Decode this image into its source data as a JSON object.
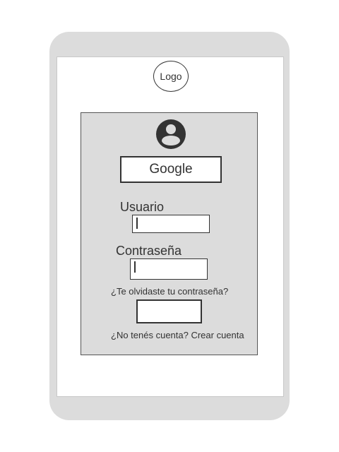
{
  "logo": {
    "text": "Logo"
  },
  "login": {
    "avatar_icon": "user-avatar-icon",
    "google_button_label": "Google",
    "username_label": "Usuario",
    "username_value": "",
    "password_label": "Contraseña",
    "password_value": "",
    "forgot_password_link": "¿Te olvidaste tu contraseña?",
    "submit_button_label": "",
    "signup_link": "¿No tenés cuenta? Crear cuenta"
  },
  "colors": {
    "device_frame": "#dcdcdc",
    "panel_background": "#dcdcdc",
    "foreground": "#333333"
  }
}
